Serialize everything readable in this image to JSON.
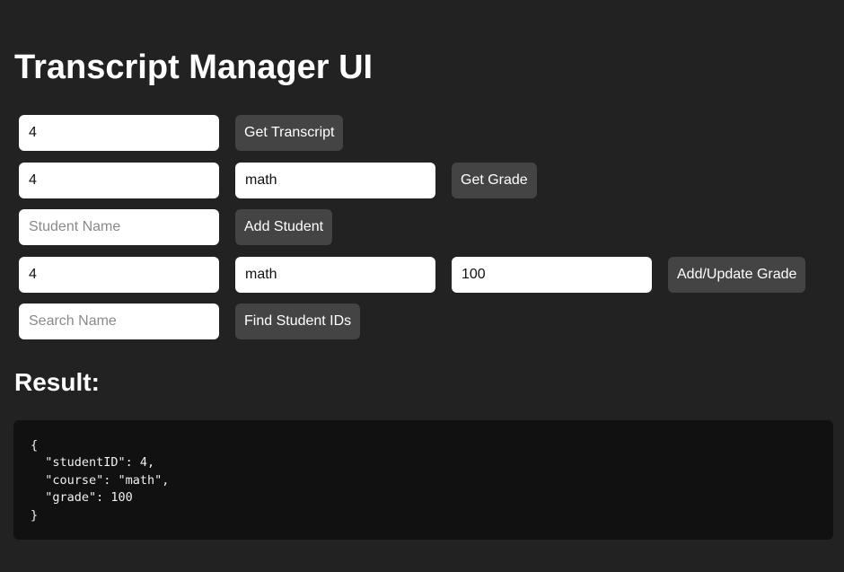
{
  "title": "Transcript Manager UI",
  "get_transcript": {
    "student_id": "4",
    "button": "Get Transcript"
  },
  "get_grade": {
    "student_id": "4",
    "course": "math",
    "button": "Get Grade"
  },
  "add_student": {
    "name_placeholder": "Student Name",
    "button": "Add Student"
  },
  "update_grade": {
    "student_id": "4",
    "course": "math",
    "grade": "100",
    "button": "Add/Update Grade"
  },
  "find_students": {
    "search_placeholder": "Search Name",
    "button": "Find Student IDs"
  },
  "result": {
    "heading": "Result:",
    "output": "{\n  \"studentID\": 4,\n  \"course\": \"math\",\n  \"grade\": 100\n}"
  },
  "colors": {
    "background": "#222222",
    "input_background": "#ffffff",
    "button_background": "#444444",
    "result_background": "#111111"
  }
}
